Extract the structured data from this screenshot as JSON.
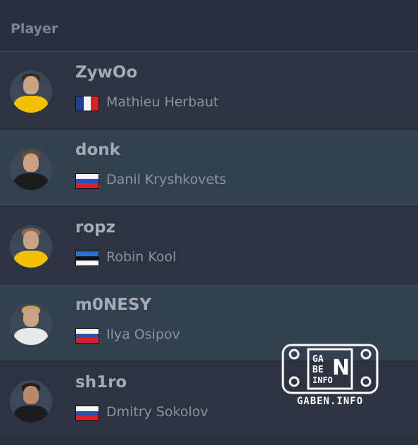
{
  "table": {
    "header_label": "Player",
    "players": [
      {
        "nick": "ZywOo",
        "name": "Mathieu Herbaut",
        "flag": "france-flag",
        "jersey": "#f2c200"
      },
      {
        "nick": "donk",
        "name": "Danil Kryshkovets",
        "flag": "russia-flag",
        "jersey": "#1c1c1e"
      },
      {
        "nick": "ropz",
        "name": "Robin Kool",
        "flag": "estonia-flag",
        "jersey": "#f2c200"
      },
      {
        "nick": "m0NESY",
        "name": "Ilya Osipov",
        "flag": "russia-flag",
        "jersey": "#e6ebe8"
      },
      {
        "nick": "sh1ro",
        "name": "Dmitry Sokolov",
        "flag": "russia-flag",
        "jersey": "#1c1c1e"
      }
    ]
  },
  "watermark": {
    "logo_lines": [
      "GA",
      "BE",
      "N",
      "INFO"
    ],
    "caption": "GABEN.INFO"
  },
  "colors": {
    "background": "#2a3340",
    "row_alt": "#324050",
    "nick_text": "#a3aab4",
    "name_text": "#8a939e"
  }
}
